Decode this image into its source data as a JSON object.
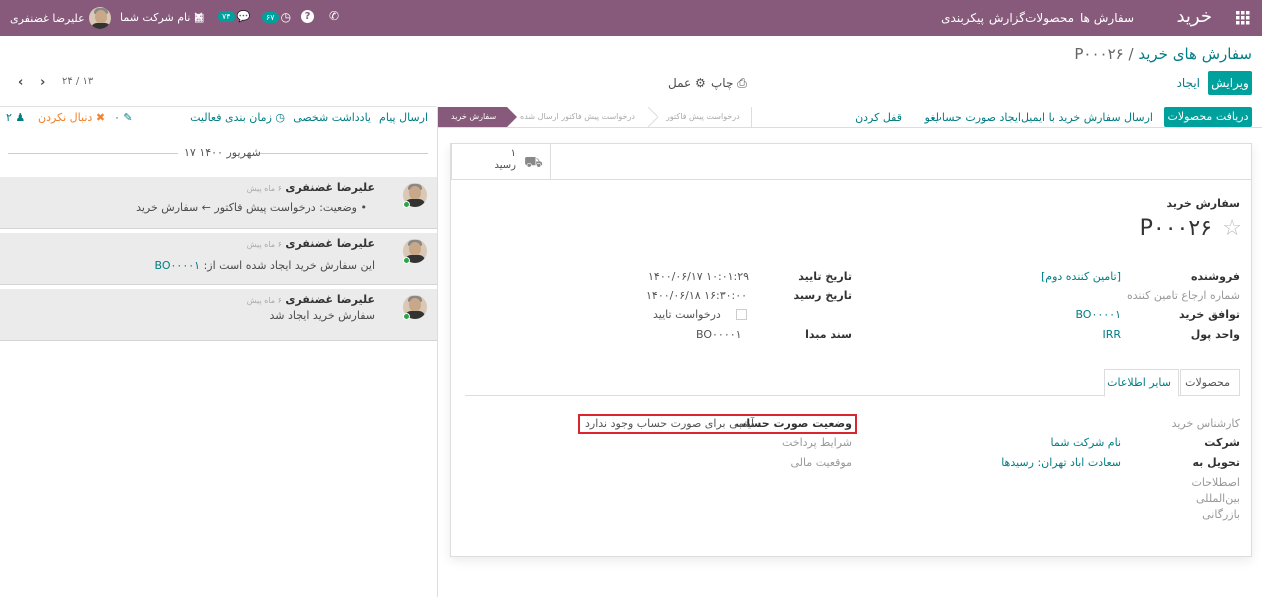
{
  "navbar": {
    "app_title": "خرید",
    "menu": [
      "سفارش ها",
      "محصولات",
      "گزارش",
      "پیکربندی"
    ],
    "user_name": "علیرضا غضنفری",
    "company_name": "نام شرکت شما",
    "messages_count": "۷۴",
    "activities_count": "۶۷"
  },
  "control": {
    "breadcrumb_parent": "سفارش های خرید",
    "breadcrumb_sep": "/",
    "breadcrumb_current": "P۰۰۰۲۶",
    "edit_label": "ویرایش",
    "create_label": "ایجاد",
    "print_label": "چاپ",
    "action_label": "عمل",
    "pager": "۲۴ / ۱۳"
  },
  "header_buttons": {
    "receive": "دریافت محصولات",
    "send_email": "ارسال سفارش خرید با ایمیل",
    "create_bill": "ایجاد صورت حساب",
    "cancel": "لغو",
    "lock": "قفل کردن"
  },
  "statusbar": [
    "سفارش خرید",
    "درخواست پیش فاکتور ارسال شده",
    "درخواست پیش فاکتور"
  ],
  "smart_button": {
    "count": "۱",
    "label": "رسید"
  },
  "form": {
    "doc_type": "سفارش خرید",
    "name": "P۰۰۰۲۶",
    "vendor_label": "فروشنده",
    "vendor_value": "[تامین کننده دوم]",
    "vendor_ref_label": "شماره ارجاع تامین کننده",
    "agreement_label": "توافق خرید",
    "agreement_value": "BO۰۰۰۰۱",
    "currency_label": "واحد پول",
    "currency_value": "IRR",
    "approval_date_label": "تاریخ تایید",
    "approval_date_value": "۱۴۰۰/۰۶/۱۷ ۱۰:۰۱:۲۹",
    "receipt_date_label": "تاریخ رسید",
    "receipt_date_value": "۱۴۰۰/۰۶/۱۸ ۱۶:۳۰:۰۰",
    "ask_confirm_label": "درخواست تایید",
    "source_label": "سند مبدا",
    "source_value": "BO۰۰۰۰۱"
  },
  "tabs": [
    "محصولات",
    "سایر اطلاعات"
  ],
  "other_info": {
    "buyer_label": "کارشناس خرید",
    "company_label": "شرکت",
    "company_value": "نام شرکت شما",
    "deliver_to_label": "تحویل به",
    "deliver_to_value": "سعادت اباد تهران: رسیدها",
    "incoterm_label": "اصطلاحات بین‌المللی بازرگانی",
    "billing_status_label": "وضعیت صورت حساب",
    "billing_status_value": "آیتمی برای صورت حساب وجود ندارد",
    "payment_terms_label": "شرایط پرداخت",
    "fiscal_position_label": "موقعیت مالی"
  },
  "chatter": {
    "send_message": "ارسال پیام",
    "log_note": "یادداشت شخصی",
    "schedule_activity": "زمان بندی فعالیت",
    "attachments_count": "۰",
    "unfollow": "دنبال نکردن",
    "followers_count": "۲",
    "date_separator": "۱۷ شهریور ۱۴۰۰",
    "messages": [
      {
        "author": "علیرضا غضنفری",
        "time": "۶ ماه پیش",
        "body": "وضعیت: درخواست پیش فاکتور ← سفارش خرید"
      },
      {
        "author": "علیرضا غضنفری",
        "time": "۶ ماه پیش",
        "body_prefix": "این سفارش خرید ایجاد شده است از:",
        "body_link": "BO۰۰۰۰۱"
      },
      {
        "author": "علیرضا غضنفری",
        "time": "۶ ماه پیش",
        "body": "سفارش خرید ایجاد شد"
      }
    ]
  },
  "colors": {
    "brand": "#875a7b",
    "primary": "#00a09d",
    "link": "#017e84",
    "highlight_border": "#d9262e"
  }
}
